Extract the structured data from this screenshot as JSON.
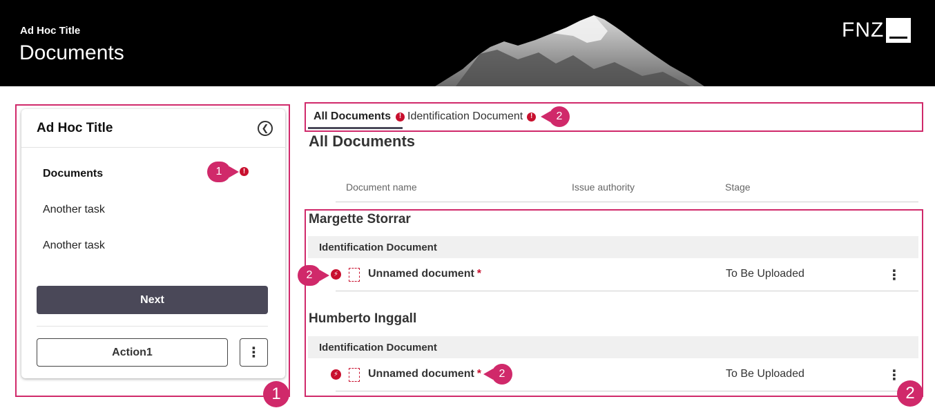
{
  "header": {
    "supertitle": "Ad Hoc Title",
    "title": "Documents",
    "logo_text": "FNZ"
  },
  "sidebar": {
    "title": "Ad Hoc Title",
    "tasks": [
      {
        "label": "Documents",
        "active": true,
        "has_error": true
      },
      {
        "label": "Another task",
        "active": false,
        "has_error": false
      },
      {
        "label": "Another task",
        "active": false,
        "has_error": false
      }
    ],
    "next_label": "Next",
    "action_label": "Action1",
    "error_symbol": "!"
  },
  "tabs": [
    {
      "label": "All Documents",
      "active": true,
      "has_error": true
    },
    {
      "label": "Identification Document",
      "active": false,
      "has_error": true
    }
  ],
  "section_title": "All Documents",
  "table": {
    "columns": [
      "Document name",
      "Issue authority",
      "Stage"
    ],
    "groups": [
      {
        "person": "Margette Storrar",
        "category": "Identification Document",
        "rows": [
          {
            "name": "Unnamed document",
            "required_mark": "*",
            "stage": "To Be Uploaded"
          }
        ]
      },
      {
        "person": "Humberto Inggall",
        "category": "Identification Document",
        "rows": [
          {
            "name": "Unnamed document",
            "required_mark": "*",
            "stage": "To Be Uploaded"
          }
        ]
      }
    ]
  },
  "annotations": {
    "panel_1": "1",
    "panel_2": "2",
    "pin_task_error": "1",
    "pin_tab_error": "2",
    "pin_row1_error": "2",
    "pin_row2_error": "2"
  },
  "colors": {
    "annotation": "#d0296a",
    "error": "#c8102e",
    "primary_button": "#4a4858",
    "header_bg": "#000000"
  },
  "icons": {
    "collapse": "chevron-left-circle-icon",
    "error": "exclamation-circle-icon",
    "bolt": "bolt-icon",
    "file": "file-dashed-icon",
    "more": "kebab-vertical-icon"
  }
}
